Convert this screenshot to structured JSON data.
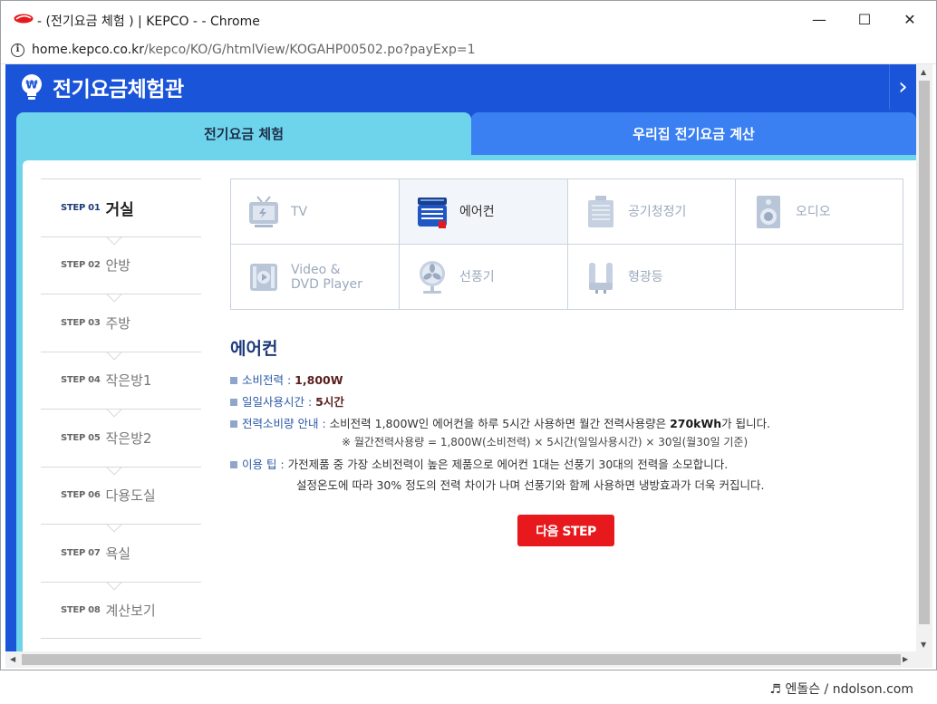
{
  "window": {
    "title": "- (전기요금 체험 ) | KEPCO - - Chrome",
    "minimize": "—",
    "maximize": "☐",
    "close": "✕"
  },
  "address": {
    "host": "home.kepco.co.kr",
    "path": "/kepco/KO/G/htmlView/KOGAHP00502.po?payExp=1"
  },
  "brand": {
    "title": "전기요금체험관"
  },
  "tabs": [
    {
      "label": "전기요금 체험"
    },
    {
      "label": "우리집 전기요금 계산"
    }
  ],
  "steps": [
    {
      "no": "STEP 01",
      "name": "거실"
    },
    {
      "no": "STEP 02",
      "name": "안방"
    },
    {
      "no": "STEP 03",
      "name": "주방"
    },
    {
      "no": "STEP 04",
      "name": "작은방1"
    },
    {
      "no": "STEP 05",
      "name": "작은방2"
    },
    {
      "no": "STEP 06",
      "name": "다용도실"
    },
    {
      "no": "STEP 07",
      "name": "욕실"
    },
    {
      "no": "STEP 08",
      "name": "계산보기"
    }
  ],
  "appliances": [
    {
      "label": "TV",
      "icon": "tv-icon"
    },
    {
      "label": "에어컨",
      "icon": "air-conditioner-icon"
    },
    {
      "label": "공기청정기",
      "icon": "air-purifier-icon"
    },
    {
      "label": "오디오",
      "icon": "speaker-icon"
    },
    {
      "label1": "Video &",
      "label2": "DVD Player",
      "icon": "video-player-icon"
    },
    {
      "label": "선풍기",
      "icon": "fan-icon"
    },
    {
      "label": "형광등",
      "icon": "fluorescent-lamp-icon"
    }
  ],
  "detail": {
    "title": "에어컨",
    "power_label": "소비전력 :",
    "power_value": "1,800W",
    "hours_label": "일일사용시간 :",
    "hours_value": "5시간",
    "usage_label": "전력소비량 안내 :",
    "usage_text_1": "소비전력 1,800W인 에어컨을 하루 5시간 사용하면 월간 전력사용량은",
    "usage_value": "270kWh",
    "usage_text_2": "가 됩니다.",
    "formula": "※ 월간전력사용량 = 1,800W(소비전력) × 5시간(일일사용시간) × 30일(월30일 기준)",
    "tip_label": "이용 팁 :",
    "tip_text_1": "가전제품 중 가장 소비전력이 높은 제품으로 에어컨 1대는 선풍기 30대의 전력을 소모합니다.",
    "tip_text_2": "설정온도에 따라 30% 정도의 전력 차이가 나며 선풍기와 함께 사용하면 냉방효과가 더욱 커집니다.",
    "next_button": "다음 STEP"
  },
  "watermark": "♬ 엔돌슨 / ndolson.com",
  "colors": {
    "header": "#1a54d8",
    "tab_active": "#6ed4ec",
    "tab_inactive": "#3a80f2",
    "next_button": "#e8191c"
  }
}
